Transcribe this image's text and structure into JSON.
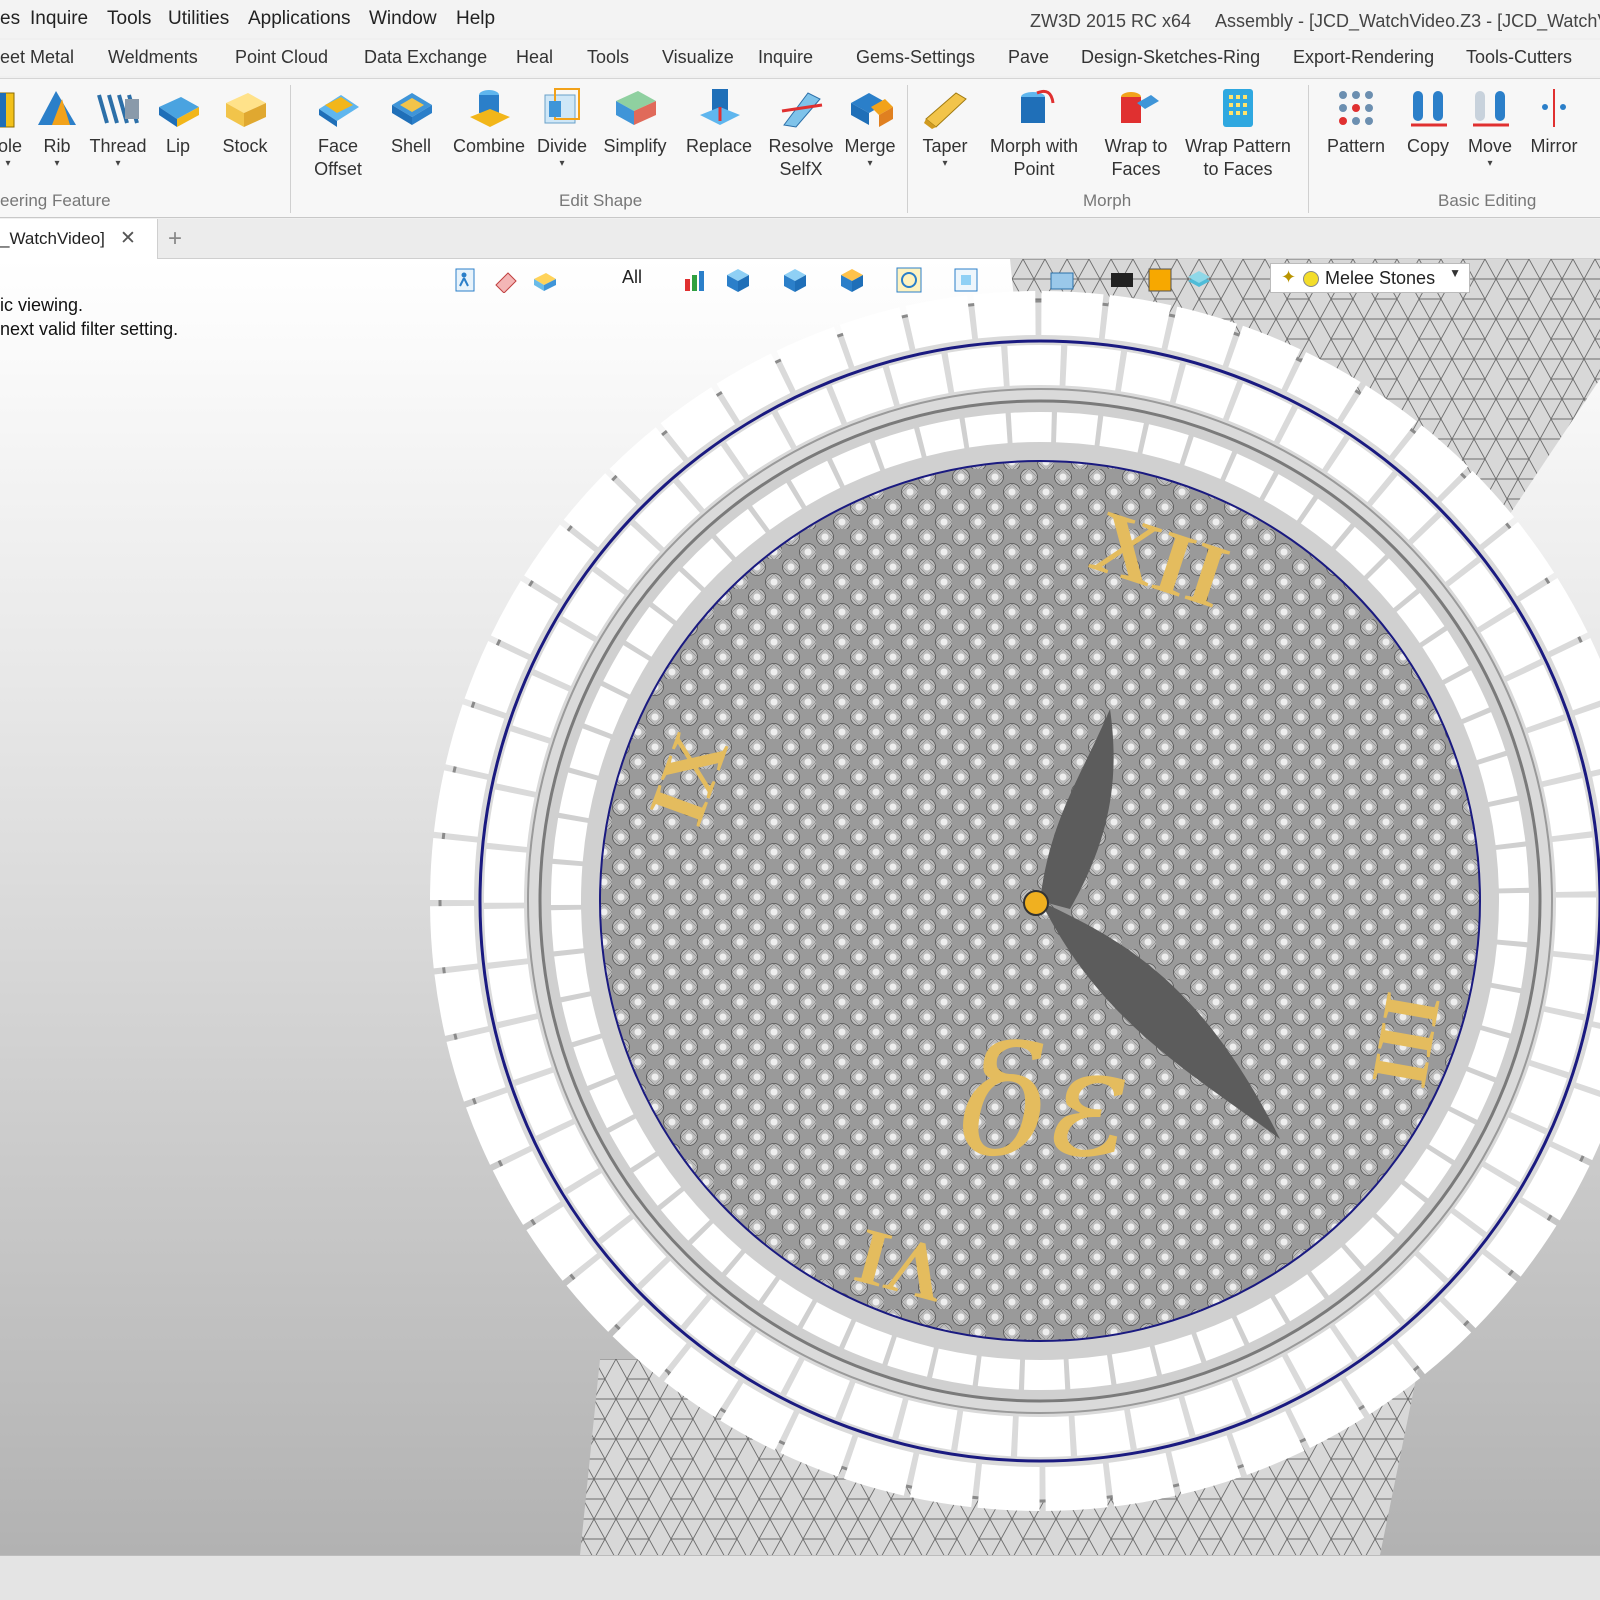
{
  "menu": [
    "es",
    "Inquire",
    "Tools",
    "Utilities",
    "Applications",
    "Window",
    "Help"
  ],
  "title": {
    "app": "ZW3D 2015 RC x64",
    "doc": "Assembly - [JCD_WatchVideo.Z3 - [JCD_WatchV"
  },
  "ribbon_tabs": [
    "eet Metal",
    "Weldments",
    "Point Cloud",
    "Data Exchange",
    "Heal",
    "Tools",
    "Visualize",
    "Inquire",
    "Gems-Settings",
    "Pave",
    "Design-Sketches-Ring",
    "Export-Rendering",
    "Tools-Cutters"
  ],
  "tools": [
    {
      "label": "ole",
      "icon": "hole-icon"
    },
    {
      "label": "Rib",
      "icon": "rib-icon"
    },
    {
      "label": "Thread",
      "icon": "thread-icon"
    },
    {
      "label": "Lip",
      "icon": "lip-icon"
    },
    {
      "label": "Stock",
      "icon": "stock-icon"
    },
    {
      "label": "Face",
      "label2": "Offset",
      "icon": "face-offset-icon"
    },
    {
      "label": "Shell",
      "icon": "shell-icon"
    },
    {
      "label": "Combine",
      "icon": "combine-icon"
    },
    {
      "label": "Divide",
      "icon": "divide-icon"
    },
    {
      "label": "Simplify",
      "icon": "simplify-icon"
    },
    {
      "label": "Replace",
      "icon": "replace-icon"
    },
    {
      "label": "Resolve",
      "label2": "SelfX",
      "icon": "resolve-selfx-icon"
    },
    {
      "label": "Merge",
      "icon": "merge-icon"
    },
    {
      "label": "Taper",
      "icon": "taper-icon"
    },
    {
      "label": "Morph with",
      "label2": "Point",
      "icon": "morph-point-icon"
    },
    {
      "label": "Wrap to",
      "label2": "Faces",
      "icon": "wrap-faces-icon"
    },
    {
      "label": "Wrap Pattern",
      "label2": "to Faces",
      "icon": "wrap-pattern-icon"
    },
    {
      "label": "Pattern",
      "icon": "pattern-icon"
    },
    {
      "label": "Copy",
      "icon": "copy-icon"
    },
    {
      "label": "Move",
      "icon": "move-icon"
    },
    {
      "label": "Mirror",
      "icon": "mirror-icon"
    }
  ],
  "groups": [
    "eering Feature",
    "Edit Shape",
    "Morph",
    "Basic Editing"
  ],
  "doc_tab": {
    "label": "_WatchVideo]",
    "close": "✕",
    "new": "+"
  },
  "viewport": {
    "hint1": "ic viewing.",
    "hint2": "next valid filter setting.",
    "filter": "All",
    "layer": "Melee Stones",
    "numerals": [
      "XII",
      "III",
      "VI",
      "IX"
    ],
    "brand_glyph": "δε"
  },
  "colors": {
    "gold": "#e4bc5e",
    "hand": "#5c5c5c",
    "accent_blue": "#1a1a80"
  }
}
